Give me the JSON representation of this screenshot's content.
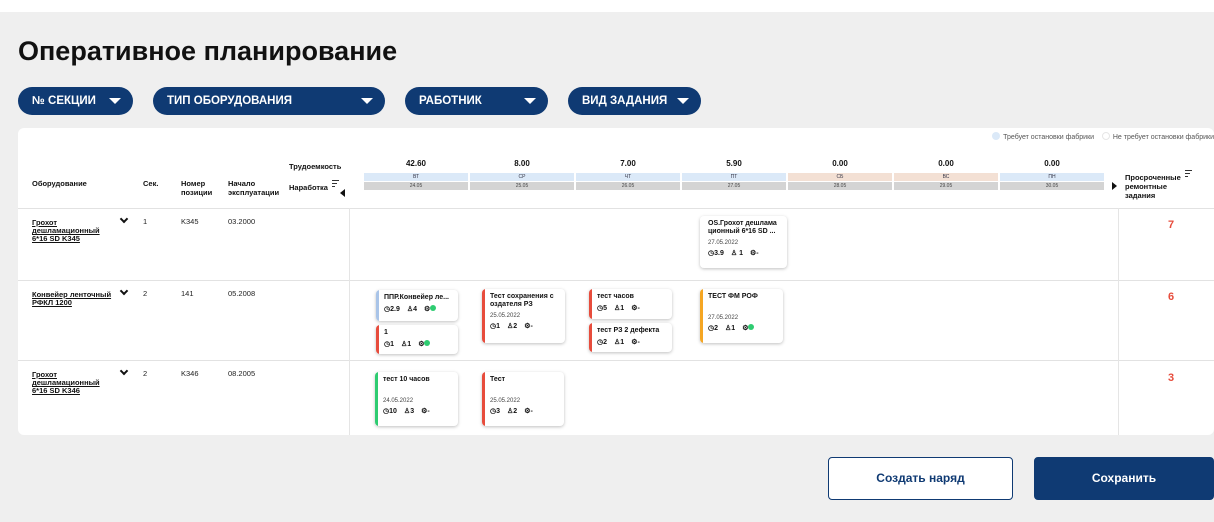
{
  "page_title": "Оперативное планирование",
  "filters": [
    "№ СЕКЦИИ",
    "ТИП ОБОРУДОВАНИЯ",
    "РАБОТНИК",
    "ВИД ЗАДАНИЯ"
  ],
  "legend": {
    "stop_label": "Требует остановки фабрики",
    "nostop_label": "Не требует остановки фабрики",
    "stop_color": "#dbe9f8",
    "nostop_color": "#f3e0d4"
  },
  "headers": {
    "equipment": "Оборудование",
    "section": "Сек.",
    "position_l1": "Номер",
    "position_l2": "позиции",
    "start_l1": "Начало",
    "start_l2": "эксплуатации",
    "labor": "Трудоемкость",
    "runtime": "Наработка",
    "overdue_l1": "Просроченные",
    "overdue_l2": "ремонтные",
    "overdue_l3": "задания"
  },
  "days": [
    {
      "labor": "42.60",
      "name": "ВТ",
      "date": "24.05",
      "type": "stop"
    },
    {
      "labor": "8.00",
      "name": "СР",
      "date": "25.05",
      "type": "stop"
    },
    {
      "labor": "7.00",
      "name": "ЧТ",
      "date": "26.05",
      "type": "stop"
    },
    {
      "labor": "5.90",
      "name": "ПТ",
      "date": "27.05",
      "type": "stop"
    },
    {
      "labor": "0.00",
      "name": "СБ",
      "date": "28.05",
      "type": "nostop"
    },
    {
      "labor": "0.00",
      "name": "ВС",
      "date": "29.05",
      "type": "nostop"
    },
    {
      "labor": "0.00",
      "name": "ПН",
      "date": "30.05",
      "type": "stop"
    }
  ],
  "rows": [
    {
      "name": "Грохот дешламационный 6*16 SD K345",
      "section": "1",
      "position": "K345",
      "start": "03.2000",
      "overdue": "7"
    },
    {
      "name": "Конвейер ленточный РФКЛ 1200",
      "section": "2",
      "position": "141",
      "start": "05.2008",
      "overdue": "6"
    },
    {
      "name": "Грохот дешламационный 6*16 SD K346",
      "section": "2",
      "position": "K346",
      "start": "08.2005",
      "overdue": "3"
    }
  ],
  "cards": [
    {
      "title": "OS.Грохот дешлама ционный 6*16 SD ...",
      "date": "27.05.2022",
      "hours": "3.9",
      "people": "1",
      "status": "-",
      "color": "#ffffff"
    },
    {
      "title": "ППР.Конвейер ле...",
      "date": "",
      "hours": "2.9",
      "people": "4",
      "status": "",
      "color": "#a9c4e8"
    },
    {
      "title": "1",
      "date": "",
      "hours": "1",
      "people": "1",
      "status": "",
      "color": "#e74c3c"
    },
    {
      "title": "Тест сохранения с оздателя РЗ",
      "date": "25.05.2022",
      "hours": "1",
      "people": "2",
      "status": "-",
      "color": "#e74c3c"
    },
    {
      "title": "тест часов",
      "date": "",
      "hours": "5",
      "people": "1",
      "status": "-",
      "color": "#e74c3c"
    },
    {
      "title": "тест РЗ 2 дефекта",
      "date": "",
      "hours": "2",
      "people": "1",
      "status": "-",
      "color": "#e74c3c"
    },
    {
      "title": "ТЕСТ ФМ РОФ",
      "date": "27.05.2022",
      "hours": "2",
      "people": "1",
      "status": "",
      "color": "#f5a623"
    },
    {
      "title": "тест 10 часов",
      "date": "24.05.2022",
      "hours": "10",
      "people": "3",
      "status": "-",
      "color": "#2ecc71"
    },
    {
      "title": "Тест",
      "date": "25.05.2022",
      "hours": "3",
      "people": "2",
      "status": "-",
      "color": "#e74c3c"
    }
  ],
  "buttons": {
    "create": "Создать наряд",
    "save": "Сохранить"
  }
}
